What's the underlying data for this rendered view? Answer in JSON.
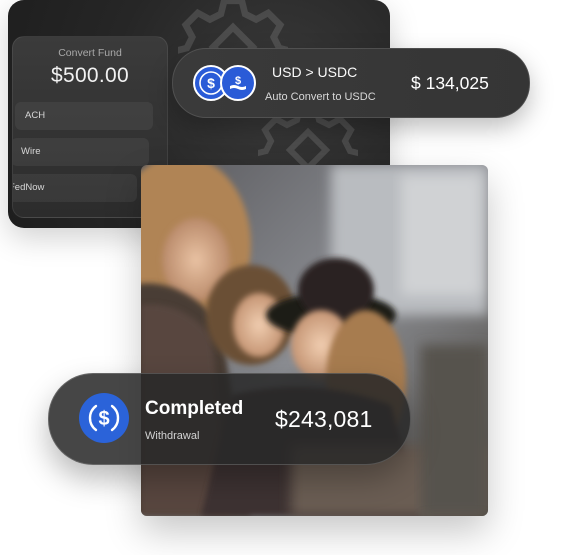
{
  "convert_panel": {
    "title": "Convert Fund",
    "amount": "$500.00",
    "methods": [
      "ACH",
      "Wire",
      "FedNow"
    ]
  },
  "conversion": {
    "icon_from": "usd-coin-icon",
    "icon_to": "usdc-coin-icon",
    "title": "USD > USDC",
    "subtitle": "Auto Convert to USDC",
    "amount": "$ 134,025"
  },
  "transaction": {
    "icon": "usdc-coin-icon",
    "status": "Completed",
    "type": "Withdrawal",
    "amount": "$243,081"
  },
  "colors": {
    "usdc_blue": "#2b63d9",
    "panel_dark": "#262626",
    "pill_dark": "#383838"
  }
}
